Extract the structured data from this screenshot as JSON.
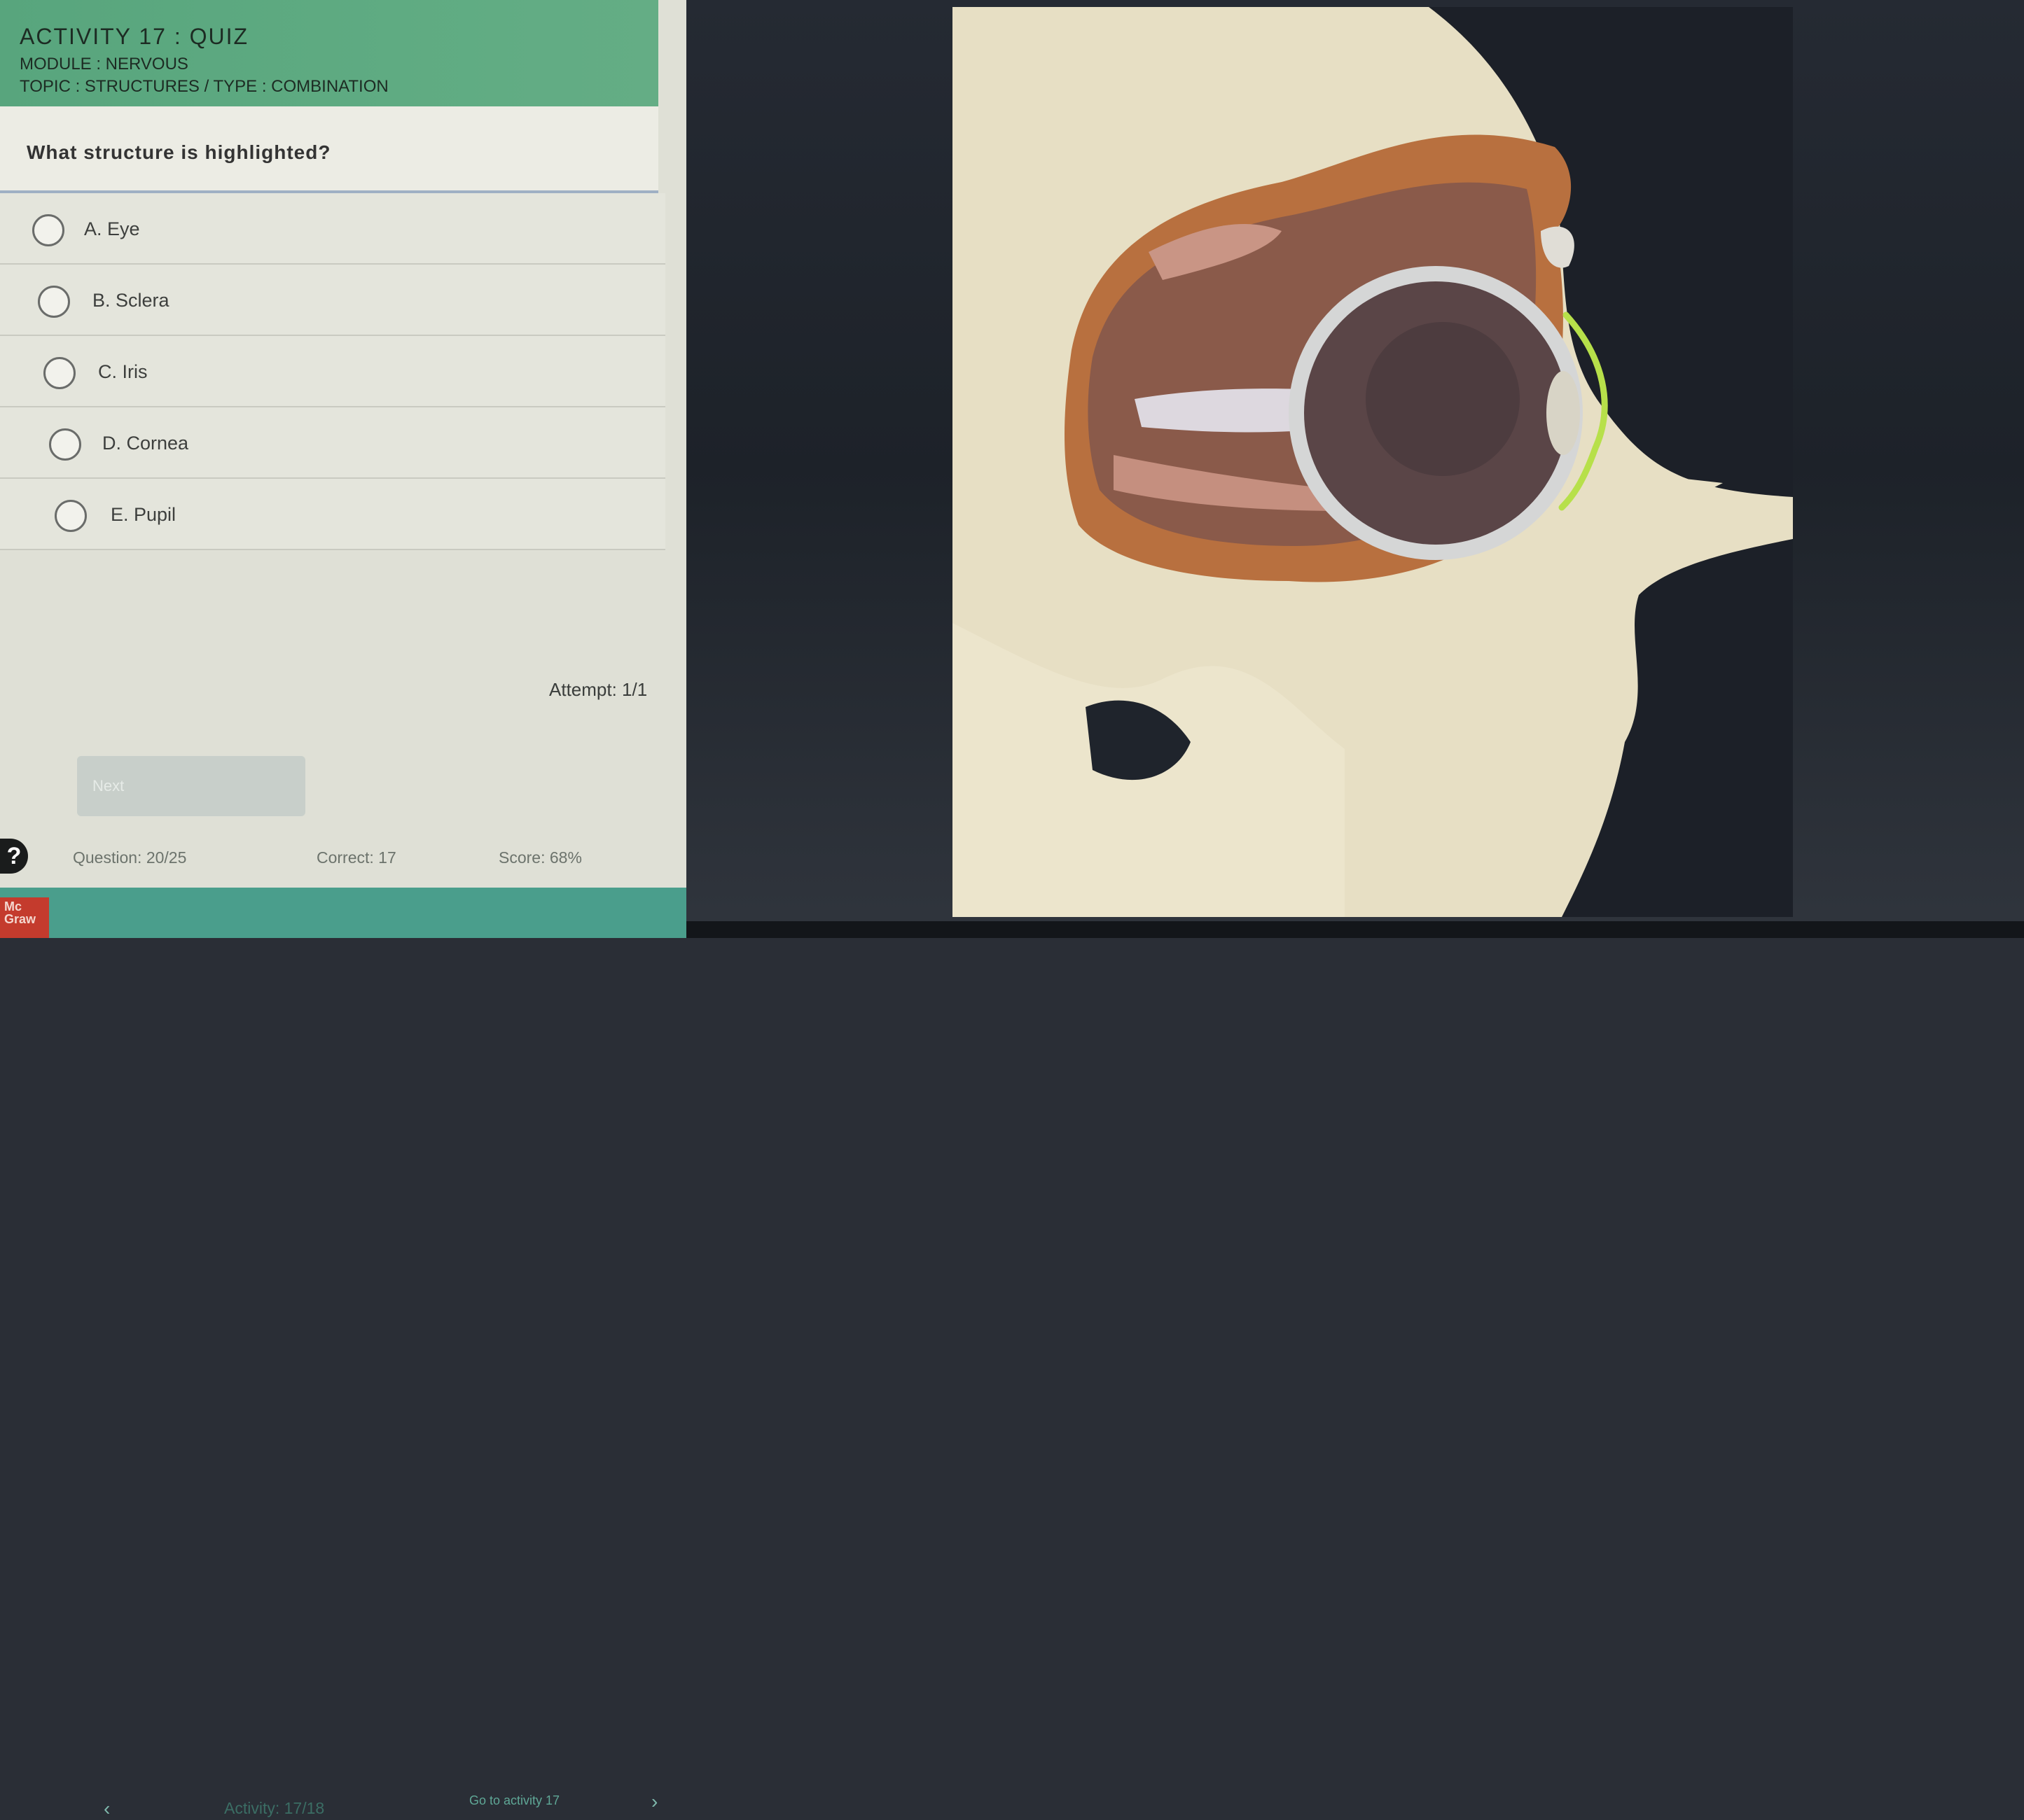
{
  "header": {
    "activity_title": "ACTIVITY 17 : QUIZ",
    "module": "MODULE : NERVOUS",
    "topic": "TOPIC : STRUCTURES  /  TYPE : COMBINATION"
  },
  "question": {
    "text": "What structure is highlighted?"
  },
  "options": [
    {
      "label": "A. Eye"
    },
    {
      "label": "B. Sclera"
    },
    {
      "label": "C. Iris"
    },
    {
      "label": "D. Cornea"
    },
    {
      "label": "E. Pupil"
    }
  ],
  "attempt": "Attempt: 1/1",
  "next_button": "Next",
  "help_icon": "?",
  "stats": {
    "question": "Question: 20/25",
    "correct": "Correct: 17",
    "score": "Score: 68%"
  },
  "footer": {
    "logo_line1": "Mc",
    "logo_line2": "Graw",
    "activity_counter": "Activity: 17/18",
    "nav_hint": "Go to activity 17",
    "prev_arrow": "‹",
    "next_arrow": "›"
  },
  "image": {
    "subject": "skull-orbit-eye-anatomy",
    "highlight_color": "#b7e04a"
  }
}
